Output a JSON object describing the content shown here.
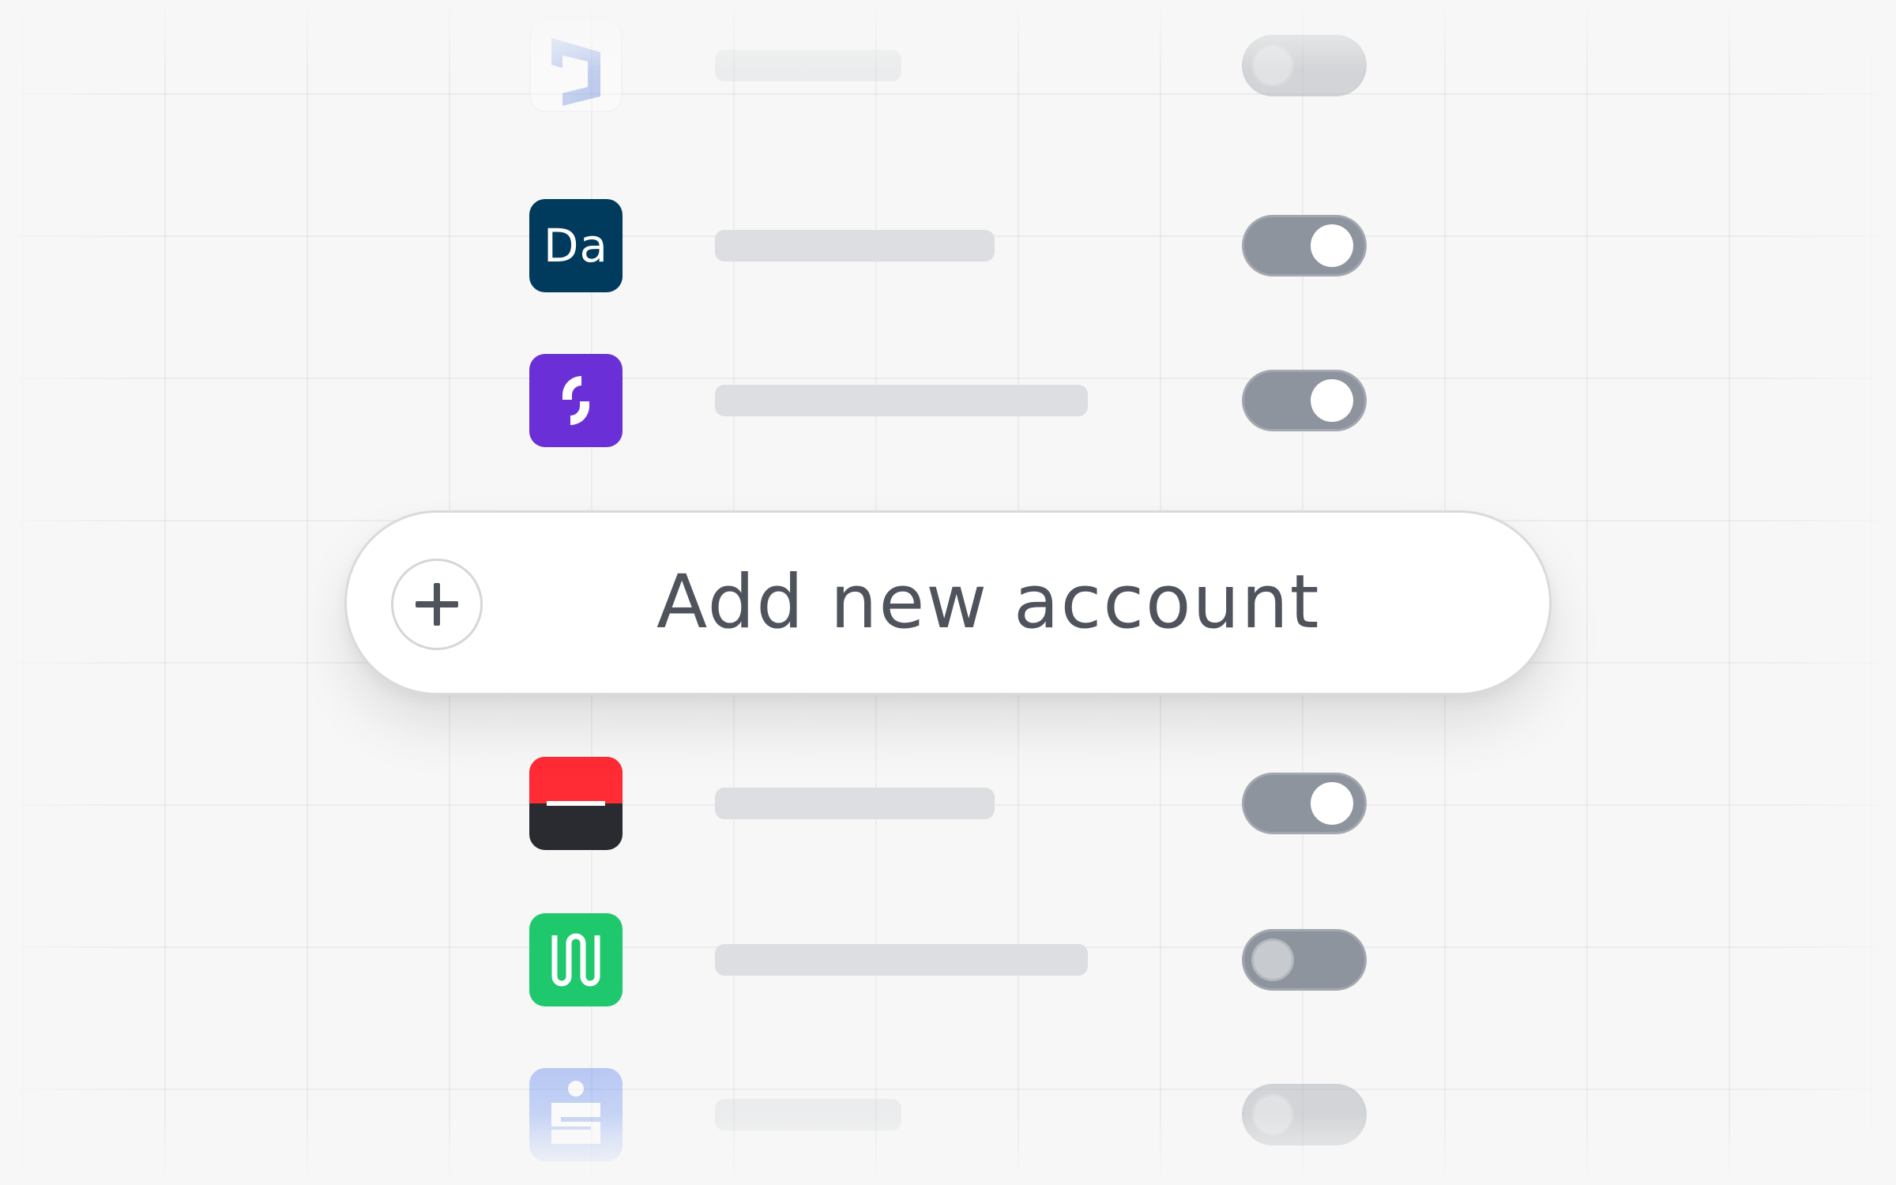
{
  "accounts": [
    {
      "icon": "blue-d-logo-icon",
      "toggle_state": "off",
      "faded": true
    },
    {
      "icon": "da-logo-icon",
      "icon_text": "Da",
      "icon_color": "#003a5c",
      "toggle_state": "on",
      "faded": false
    },
    {
      "icon": "purple-s-logo-icon",
      "icon_color": "#6a2fd6",
      "toggle_state": "on",
      "faded": false
    },
    {
      "icon": "red-black-bank-logo-icon",
      "icon_color": "#ff2b35",
      "toggle_state": "on",
      "faded": false
    },
    {
      "icon": "green-w-logo-icon",
      "icon_color": "#1fc86c",
      "toggle_state": "off",
      "faded": false
    },
    {
      "icon": "sparkasse-logo-icon",
      "icon_color": "#6b8ff0",
      "toggle_state": "off",
      "faded": true
    }
  ],
  "add_account": {
    "label": "Add new account",
    "icon": "plus-icon"
  },
  "colors": {
    "background": "#f7f7f7",
    "placeholder": "#dcdee1",
    "toggle_on": "#8e949e",
    "label_text": "#4f545c"
  }
}
